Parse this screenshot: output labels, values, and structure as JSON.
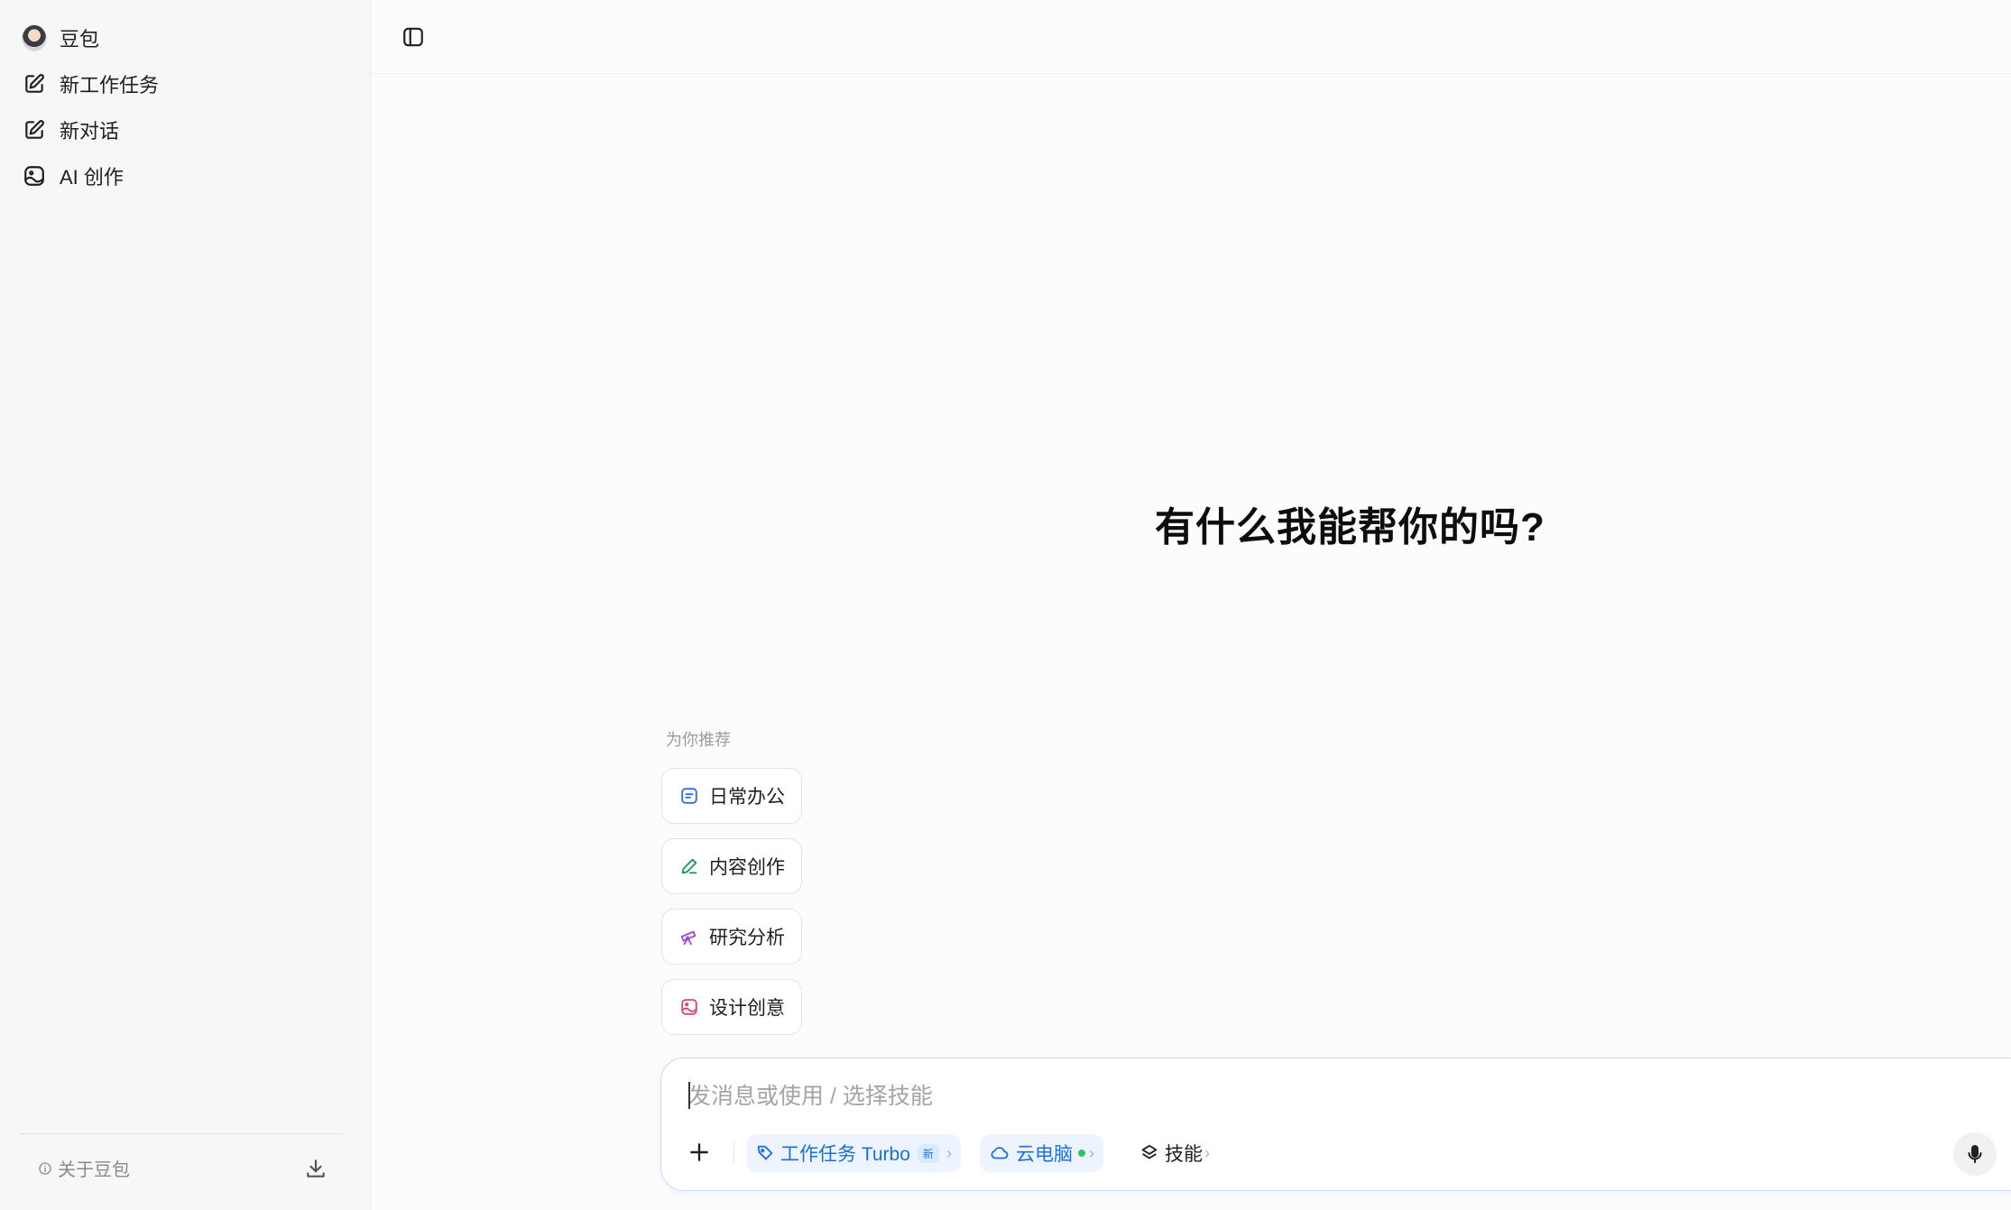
{
  "sidebar": {
    "items": [
      {
        "label": "豆包",
        "icon": "avatar"
      },
      {
        "label": "新工作任务",
        "icon": "edit-icon"
      },
      {
        "label": "新对话",
        "icon": "edit-icon"
      },
      {
        "label": "AI 创作",
        "icon": "image-icon"
      }
    ],
    "about_label": "关于豆包"
  },
  "main": {
    "headline": "有什么我能帮你的吗?",
    "recommend_title": "为你推荐",
    "recommendations": [
      {
        "label": "日常办公",
        "icon": "document-icon",
        "color": "#2f6fdc"
      },
      {
        "label": "内容创作",
        "icon": "pen-icon",
        "color": "#1f9a57"
      },
      {
        "label": "研究分析",
        "icon": "telescope-icon",
        "color": "#9b4bd6"
      },
      {
        "label": "设计创意",
        "icon": "image-icon",
        "color": "#d6457f"
      }
    ]
  },
  "composer": {
    "placeholder": "发消息或使用 / 选择技能",
    "turbo_label": "工作任务 Turbo",
    "turbo_badge": "新",
    "cloud_label": "云电脑",
    "skills_label": "技能",
    "accent": "#1a6fd8"
  }
}
